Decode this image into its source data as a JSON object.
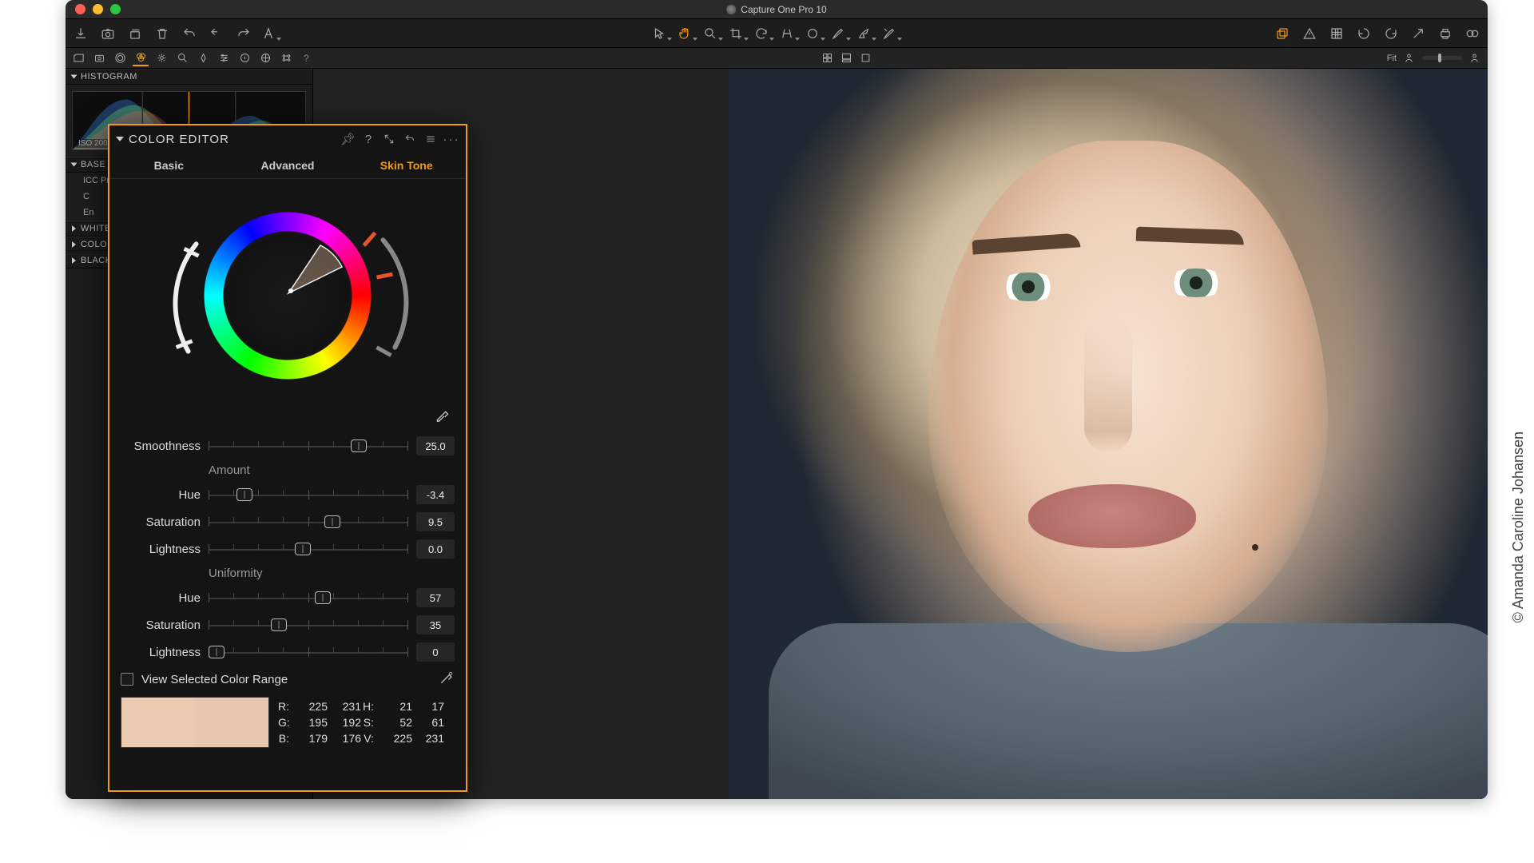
{
  "app": {
    "title": "Capture One Pro 10"
  },
  "toolstrip_right": {
    "fit_label": "Fit"
  },
  "sidebar": {
    "histogram": {
      "title": "HISTOGRAM",
      "meta": "ISO 200"
    },
    "panels": [
      {
        "title": "BASE C"
      },
      {
        "title": "WHITE"
      },
      {
        "title": "COLOR"
      },
      {
        "title": "BLACK"
      }
    ],
    "base_rows": [
      "ICC Pr",
      "C",
      "En"
    ]
  },
  "color_editor": {
    "title": "COLOR EDITOR",
    "tabs": {
      "basic": "Basic",
      "advanced": "Advanced",
      "skin": "Skin Tone"
    },
    "smoothness": {
      "label": "Smoothness",
      "value": "25.0",
      "pos": 75
    },
    "amount_label": "Amount",
    "amount": {
      "hue": {
        "label": "Hue",
        "value": "-3.4",
        "pos": 18
      },
      "saturation": {
        "label": "Saturation",
        "value": "9.5",
        "pos": 62
      },
      "lightness": {
        "label": "Lightness",
        "value": "0.0",
        "pos": 47
      }
    },
    "uniformity_label": "Uniformity",
    "uniformity": {
      "hue": {
        "label": "Hue",
        "value": "57",
        "pos": 57
      },
      "saturation": {
        "label": "Saturation",
        "value": "35",
        "pos": 35
      },
      "lightness": {
        "label": "Lightness",
        "value": "0",
        "pos": 4
      }
    },
    "view_range_label": "View Selected Color Range",
    "swatch_colors": [
      "#eccab2",
      "#e8c5ae"
    ],
    "readout": {
      "R": [
        "225",
        "231"
      ],
      "G": [
        "195",
        "192"
      ],
      "B": [
        "179",
        "176"
      ],
      "H": [
        "21",
        "17"
      ],
      "S": [
        "52",
        "61"
      ],
      "V": [
        "225",
        "231"
      ]
    }
  },
  "credit": "© Amanda Caroline Johansen"
}
